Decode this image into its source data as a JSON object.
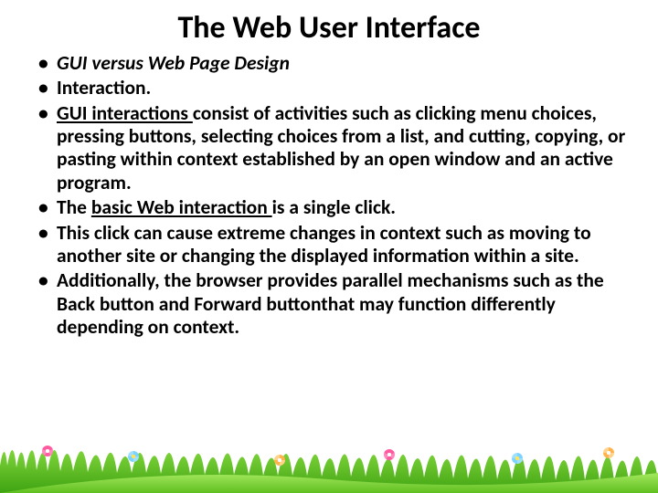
{
  "title": "The Web User Interface",
  "bullets": [
    {
      "html": "<span class='italic'>GUI versus Web Page Design</span>"
    },
    {
      "html": "Interaction."
    },
    {
      "html": "<span class='u'>GUI interactions </span>consist of activities such as clicking menu choices, pressing buttons, selecting choices from a list, and cutting, copying, or pasting within context established by an open window and an active program."
    },
    {
      "html": "The <span class='u'>basic Web interaction </span>is a single click."
    },
    {
      "html": "This click can cause extreme changes in context such as moving to another site or changing the displayed information within a site."
    },
    {
      "html": "Additionally, the browser provides parallel mechanisms such as the Back button and Forward buttonthat may function differently depending on context."
    }
  ]
}
